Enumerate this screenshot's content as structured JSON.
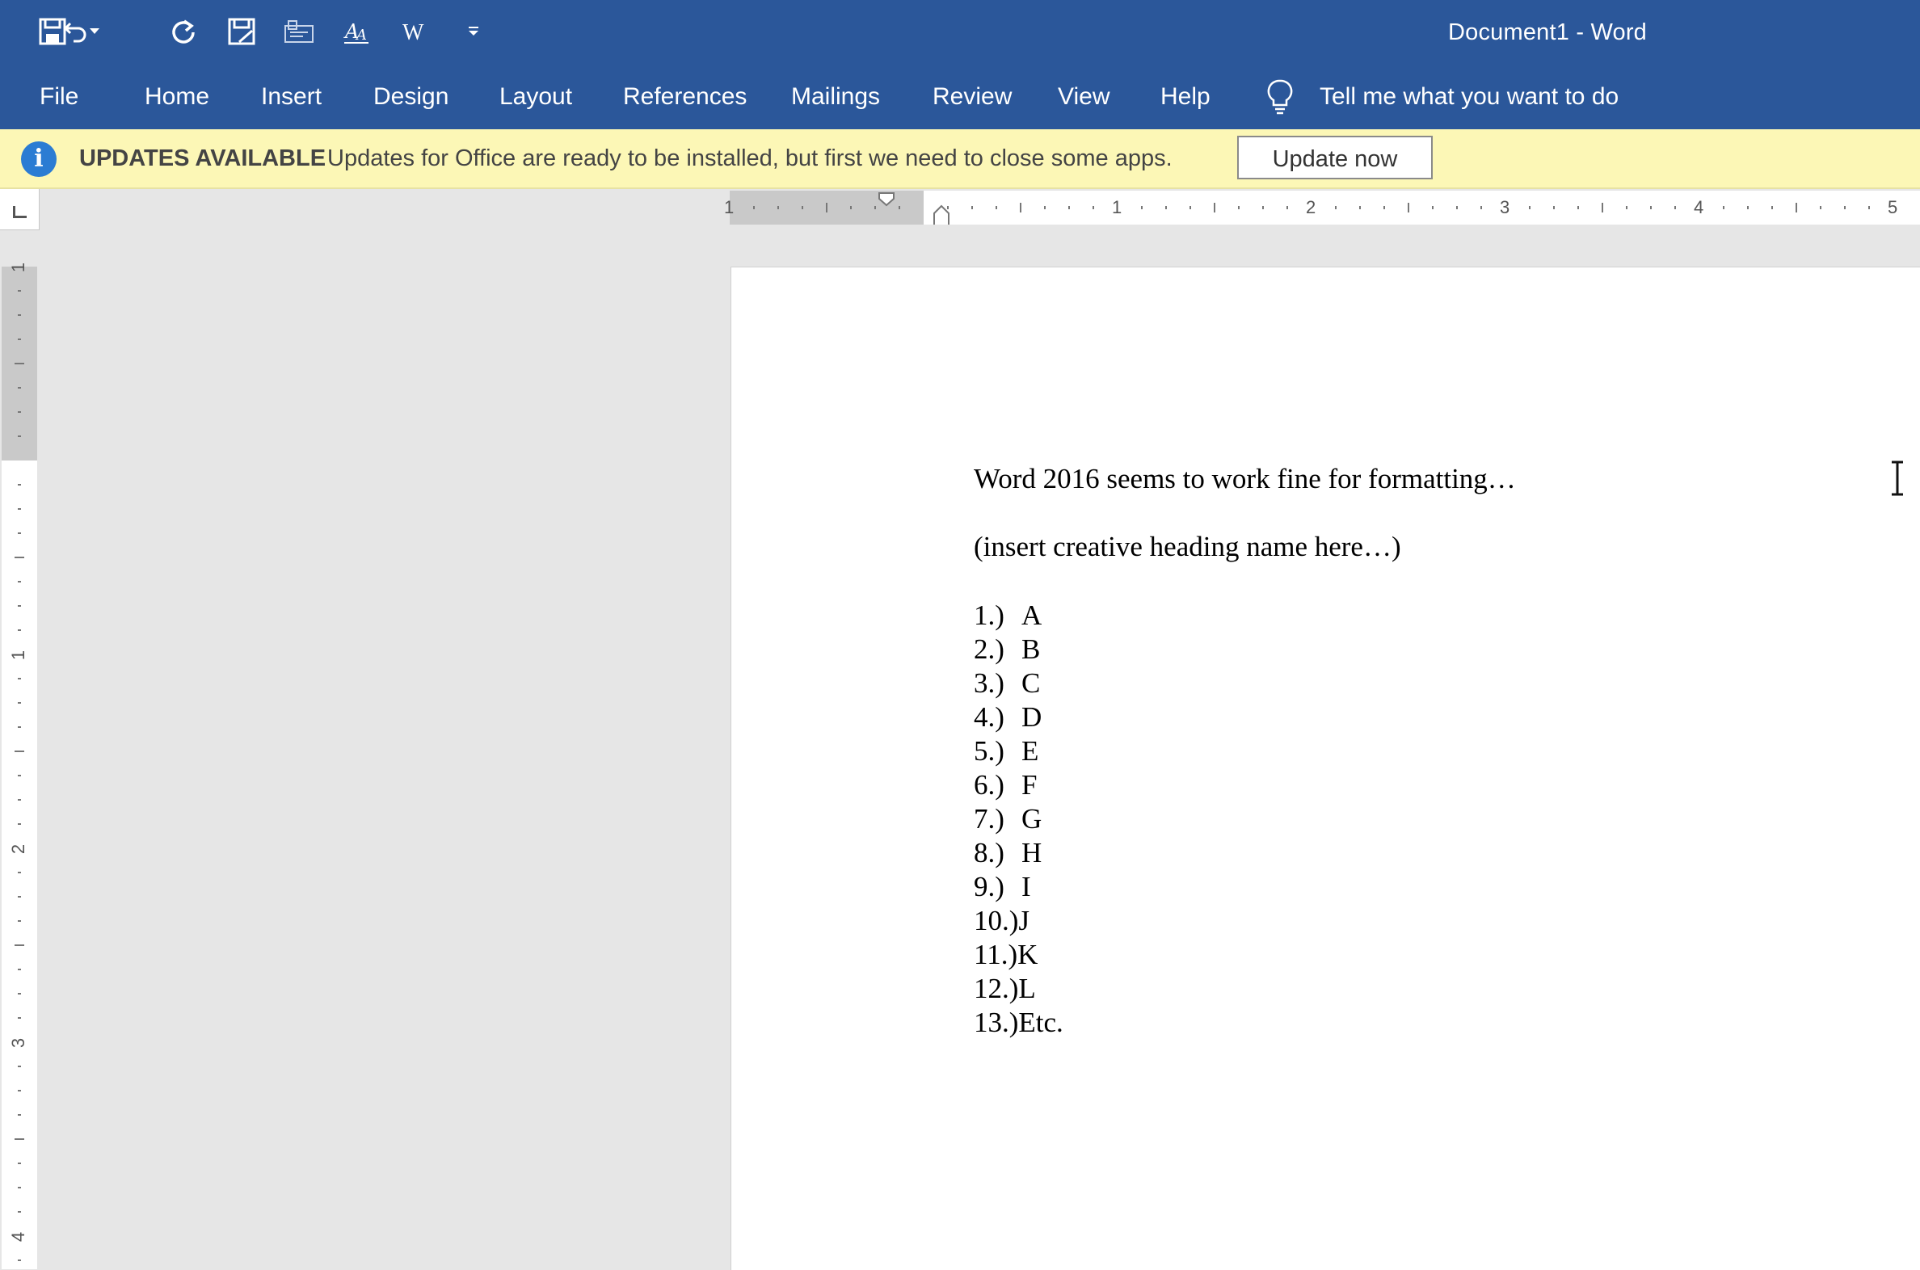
{
  "title_bar": {
    "document_title": "Document1  -  Word",
    "quick_access": [
      "save-icon",
      "undo-icon",
      "undo-dropdown-icon",
      "redo-icon",
      "save-as-icon",
      "print-preview-icon",
      "spelling-icon",
      "word-logo-icon",
      "customize-quick-access-icon"
    ]
  },
  "ribbon": {
    "tabs": [
      "File",
      "Home",
      "Insert",
      "Design",
      "Layout",
      "References",
      "Mailings",
      "Review",
      "View",
      "Help"
    ],
    "tell_me": "Tell me what you want to do"
  },
  "update_bar": {
    "title": "UPDATES AVAILABLE",
    "message": "Updates for Office are ready to be installed, but first we need to close some apps.",
    "button": "Update now"
  },
  "rulers": {
    "horizontal_labels": [
      "1",
      "1",
      "2",
      "3",
      "4",
      "5"
    ],
    "vertical_labels": [
      "1",
      "1",
      "2",
      "3",
      "4"
    ]
  },
  "document": {
    "line1": "Word 2016 seems to work fine for formatting…",
    "line2": "(insert creative heading name here…)",
    "list": [
      {
        "num": "1.)",
        "text": "A"
      },
      {
        "num": "2.)",
        "text": "B"
      },
      {
        "num": "3.)",
        "text": "C"
      },
      {
        "num": "4.)",
        "text": "D"
      },
      {
        "num": "5.)",
        "text": "E"
      },
      {
        "num": "6.)",
        "text": "F"
      },
      {
        "num": "7.)",
        "text": "G"
      },
      {
        "num": "8.)",
        "text": "H"
      },
      {
        "num": "9.)",
        "text": "I"
      },
      {
        "num": "10.)",
        "text": "J"
      },
      {
        "num": "11.)",
        "text": "K"
      },
      {
        "num": "12.)",
        "text": "L"
      },
      {
        "num": "13.)",
        "text": "Etc."
      }
    ]
  },
  "colors": {
    "ribbon": "#2b579a",
    "update_bar": "#fcf7b6",
    "info_icon": "#2b7cd3",
    "workspace": "#e6e6e6"
  }
}
